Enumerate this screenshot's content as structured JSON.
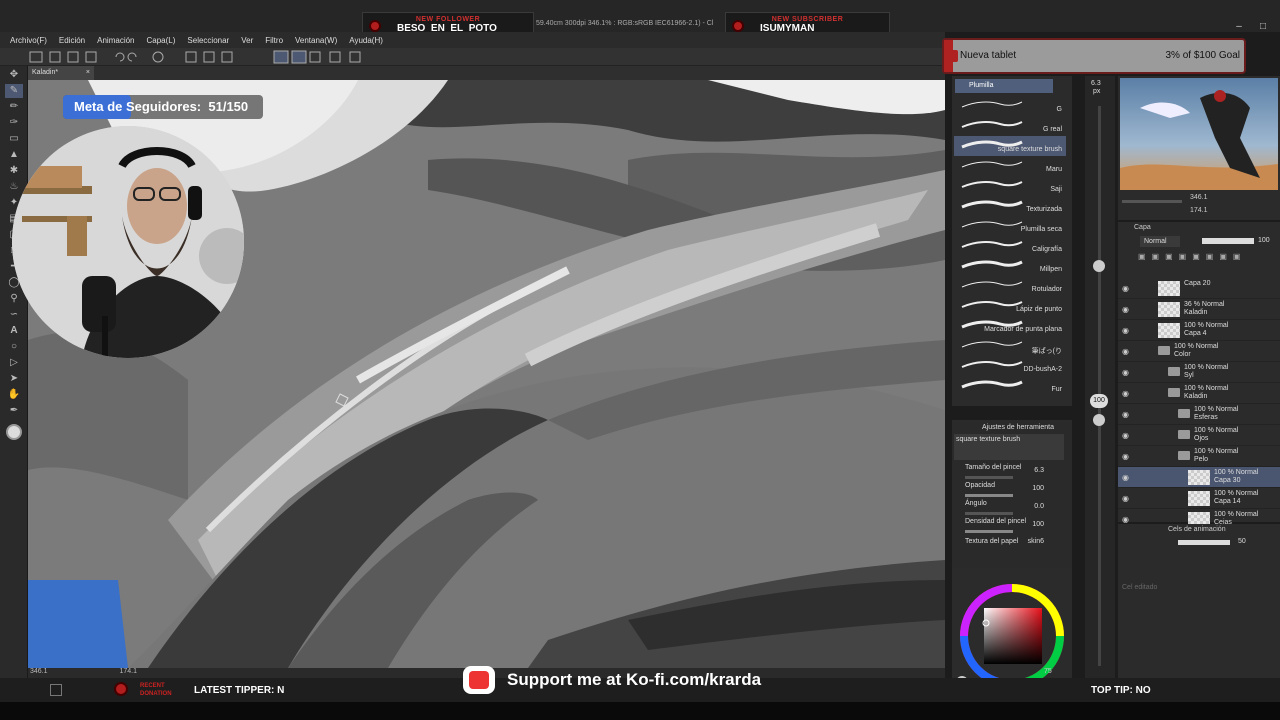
{
  "stream_alerts": {
    "follower_header": "NEW FOLLOWER",
    "follower_name": "BESO_EN_EL_POTO",
    "subscriber_header": "NEW SUBSCRIBER",
    "subscriber_name": "ISUMYMAN",
    "doc_info": "59.40cm 300dpi 346.1% : RGB:sRGB IEC61966-2.1) - Cl"
  },
  "menu": [
    "Archivo(F)",
    "Edición",
    "Animación",
    "Capa(L)",
    "Seleccionar",
    "Ver",
    "Filtro",
    "Ventana(W)",
    "Ayuda(H)"
  ],
  "canvas_tab": "Kaladin*",
  "goal": {
    "label": "Meta de Seguidores:",
    "current": "51/150",
    "progress_fraction": 0.34
  },
  "tip_goal": {
    "name": "Nueva tablet",
    "amount": "3% of $100 Goal",
    "progress_fraction": 0.03
  },
  "brush_panel": {
    "header": "Plumilla",
    "brushes": [
      "G",
      "G real",
      "square texture brush",
      "Maru",
      "Saji",
      "Texturizada",
      "Plumilla seca",
      "Caligrafía",
      "Millpen",
      "Rotulador",
      "Lápiz de punto",
      "Marcador de punta plana",
      "筆ぱっ(り",
      "DD-bushA-2",
      "Fur"
    ],
    "selected": "square texture brush"
  },
  "tool_settings": {
    "title": "Ajustes de herramienta",
    "brush_name": "square texture brush",
    "rows": [
      {
        "label": "Tamaño del pincel",
        "value": "6.3"
      },
      {
        "label": "Opacidad",
        "value": "100"
      },
      {
        "label": "Ángulo",
        "value": "0.0"
      },
      {
        "label": "Densidad del pincel",
        "value": "100"
      },
      {
        "label": "Textura del papel",
        "value": "skin6"
      }
    ]
  },
  "size_column": {
    "size": "6.3",
    "size_unit": "px",
    "opacity": "100"
  },
  "navigator": {
    "zoom": "346.1",
    "rotation": "174.1"
  },
  "layers": {
    "tab": "Capa",
    "blend_mode": "Normal",
    "opacity": "100",
    "items": [
      {
        "pct": "Capa 20",
        "name": "",
        "kind": "layer",
        "indent": 0
      },
      {
        "pct": "36 % Normal",
        "name": "Kaladin",
        "kind": "layer",
        "indent": 0
      },
      {
        "pct": "100 % Normal",
        "name": "Capa 4",
        "kind": "layer",
        "indent": 0
      },
      {
        "pct": "100 % Normal",
        "name": "Color",
        "kind": "folder",
        "indent": 0
      },
      {
        "pct": "100 % Normal",
        "name": "Syl",
        "kind": "folder",
        "indent": 1
      },
      {
        "pct": "100 % Normal",
        "name": "Kaladin",
        "kind": "folder",
        "indent": 1
      },
      {
        "pct": "100 % Normal",
        "name": "Esferas",
        "kind": "folder",
        "indent": 2
      },
      {
        "pct": "100 % Normal",
        "name": "Ojos",
        "kind": "folder",
        "indent": 2
      },
      {
        "pct": "100 % Normal",
        "name": "Pelo",
        "kind": "folder",
        "indent": 2
      },
      {
        "pct": "100 % Normal",
        "name": "Capa 30",
        "kind": "layer",
        "indent": 3,
        "selected": true
      },
      {
        "pct": "100 % Normal",
        "name": "Capa 14",
        "kind": "layer",
        "indent": 3
      },
      {
        "pct": "100 % Normal",
        "name": "Cejas",
        "kind": "layer",
        "indent": 3
      }
    ]
  },
  "animation": {
    "tab": "Cels de animación",
    "value": "50",
    "placeholder": "Cel editado"
  },
  "canvas_status": {
    "zoom": "346.1",
    "angle": "174.1"
  },
  "bottom": {
    "recent_donation": "RECENT DONATION",
    "latest_tipper": "LATEST TIPPER: N",
    "kofi": "Support me at Ko-fi.com/krarda",
    "top_tip": "TOP TIP: NO",
    "color_count": "75"
  },
  "colors": {
    "accent": "#3b6fd6",
    "alert_red": "#d23030",
    "selected_row": "#4d5872"
  }
}
